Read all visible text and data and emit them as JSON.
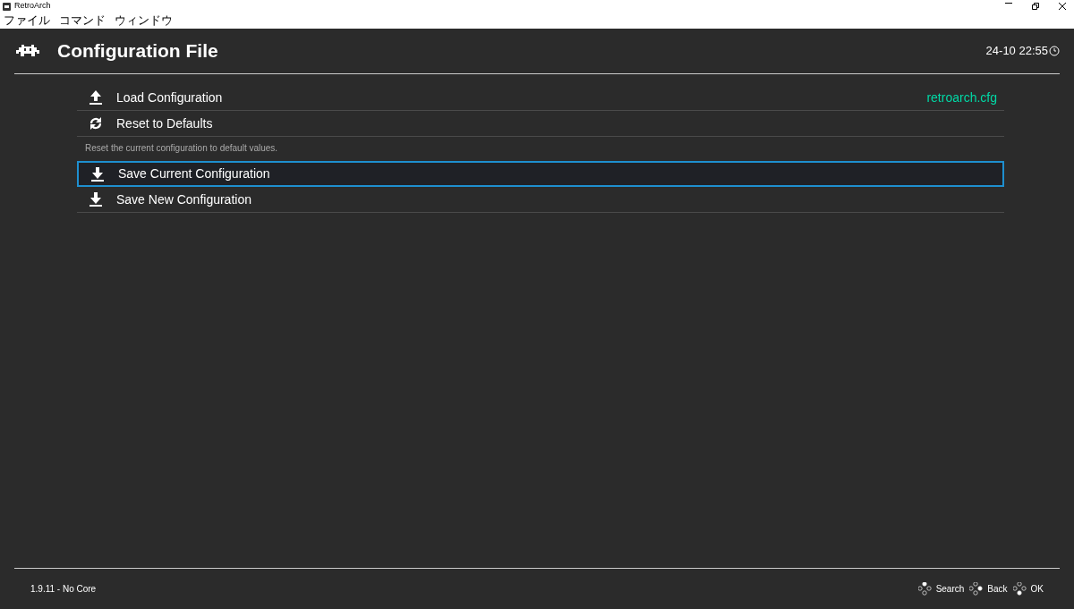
{
  "window": {
    "title": "RetroArch"
  },
  "menubar": [
    "ファイル",
    "コマンド",
    "ウィンドウ"
  ],
  "header": {
    "title": "Configuration File",
    "clock": "24-10 22:55"
  },
  "items": [
    {
      "kind": "upload",
      "label": "Load Configuration",
      "value": "retroarch.cfg",
      "selected": false
    },
    {
      "kind": "reset",
      "label": "Reset to Defaults",
      "selected": false
    },
    {
      "kind": "description",
      "label": "Reset the current configuration to default values."
    },
    {
      "kind": "download",
      "label": "Save Current Configuration",
      "selected": true
    },
    {
      "kind": "download",
      "label": "Save New Configuration",
      "selected": false
    }
  ],
  "footer": {
    "version": "1.9.11 - No Core",
    "hints": [
      {
        "kind": "top",
        "label": "Search"
      },
      {
        "kind": "right",
        "label": "Back"
      },
      {
        "kind": "bottom",
        "label": "OK"
      }
    ]
  }
}
